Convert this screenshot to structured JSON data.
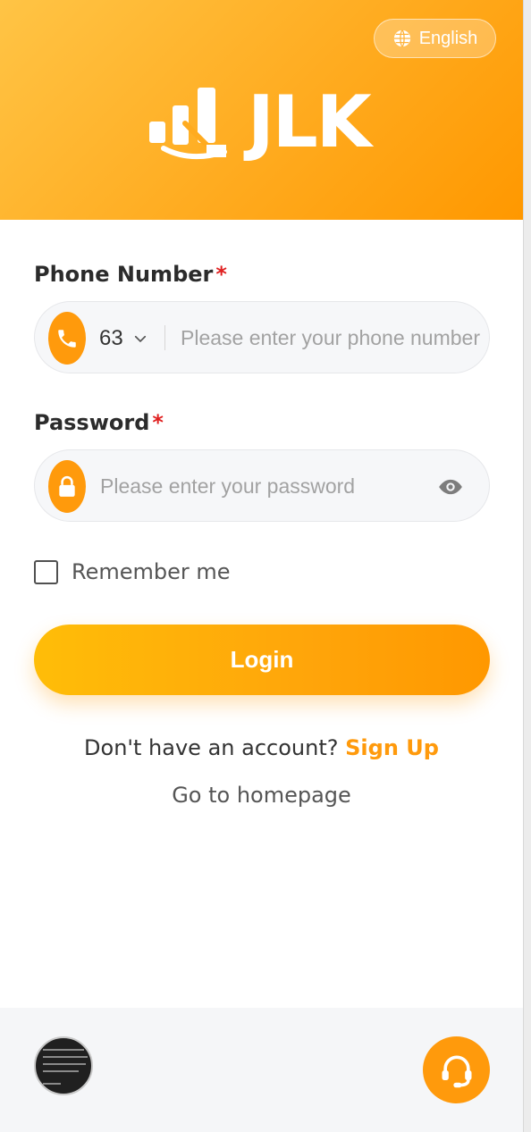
{
  "header": {
    "language_label": "English",
    "logo_text": "JLK"
  },
  "form": {
    "phone": {
      "label": "Phone Number",
      "required_mark": "*",
      "country_code": "63",
      "placeholder": "Please enter your phone number",
      "value": ""
    },
    "password": {
      "label": "Password",
      "required_mark": "*",
      "placeholder": "Please enter your password",
      "value": ""
    },
    "remember_me": {
      "label": "Remember me",
      "checked": false
    },
    "login_button": "Login"
  },
  "links": {
    "no_account_text": "Don't have an account?",
    "sign_up": "Sign Up",
    "go_home": "Go to homepage"
  },
  "colors": {
    "accent": "#ff9a0c",
    "header_gradient_start": "#ffc445",
    "header_gradient_end": "#ff9800",
    "required": "#e02020"
  },
  "icons": {
    "language": "globe-icon",
    "phone": "phone-icon",
    "country_dropdown": "chevron-down-icon",
    "password": "lock-icon",
    "show_password": "eye-icon",
    "support": "headset-icon"
  }
}
